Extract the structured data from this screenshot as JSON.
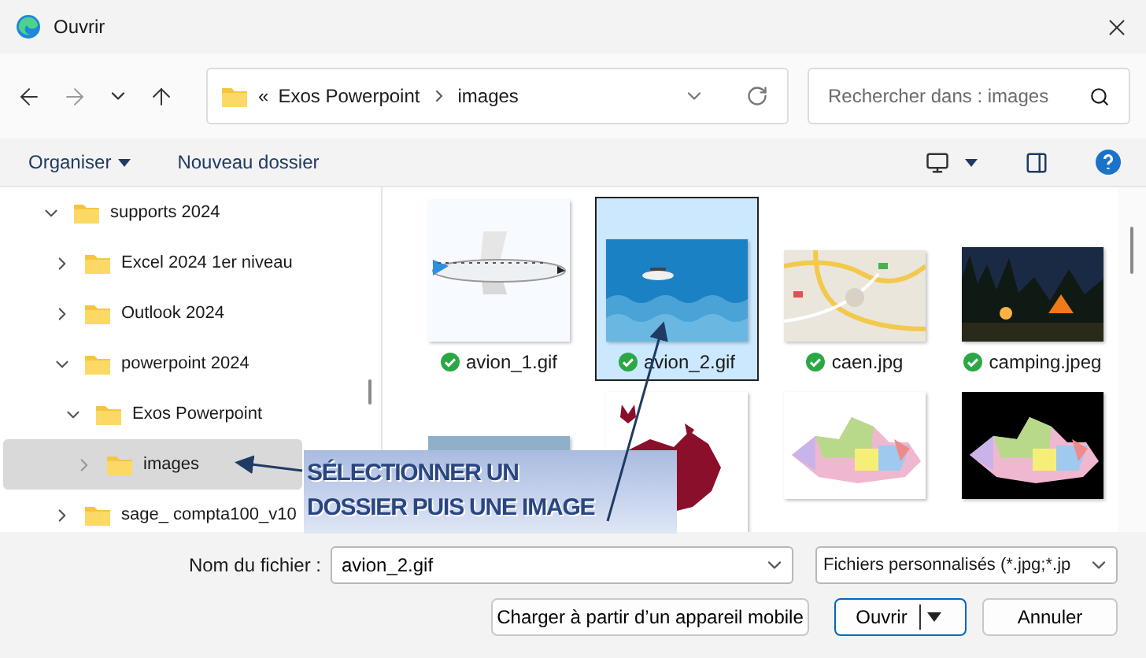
{
  "window": {
    "title": "Ouvrir"
  },
  "address": {
    "overflow": "«",
    "crumbs": [
      "Exos Powerpoint",
      "images"
    ]
  },
  "search": {
    "placeholder": "Rechercher dans : images"
  },
  "toolbar": {
    "organize": "Organiser",
    "new_folder": "Nouveau dossier"
  },
  "tree": [
    {
      "label": "supports 2024",
      "expanded": true,
      "selected": false,
      "children": [
        {
          "label": "Excel 2024 1er niveau",
          "expanded": false,
          "selected": false
        },
        {
          "label": "Outlook 2024",
          "expanded": false,
          "selected": false
        },
        {
          "label": "powerpoint 2024",
          "expanded": true,
          "selected": false,
          "children": [
            {
              "label": "Exos Powerpoint",
              "expanded": true,
              "selected": false,
              "children": [
                {
                  "label": "images",
                  "expanded": false,
                  "selected": true
                }
              ]
            }
          ]
        },
        {
          "label": "sage_ compta100_v10",
          "expanded": false,
          "selected": false
        }
      ]
    }
  ],
  "files": [
    {
      "name": "avion_1.gif",
      "synced": true,
      "selected": false
    },
    {
      "name": "avion_2.gif",
      "synced": true,
      "selected": true
    },
    {
      "name": "caen.jpg",
      "synced": true,
      "selected": false
    },
    {
      "name": "camping.jpeg",
      "synced": true,
      "selected": false
    },
    {
      "selected": false
    },
    {
      "selected": false
    },
    {
      "selected": false
    },
    {
      "selected": false
    }
  ],
  "callout": {
    "lines": [
      "SÉLECTIONNER UN",
      "DOSSIER PUIS UNE IMAGE"
    ]
  },
  "footer": {
    "filename_label": "Nom du fichier :",
    "filename": "avion_2.gif",
    "filter": "Fichiers personnalisés (*.jpg;*.jp",
    "buttons": [
      "Charger à partir d’un appareil mobile",
      "Ouvrir",
      "Annuler"
    ]
  }
}
